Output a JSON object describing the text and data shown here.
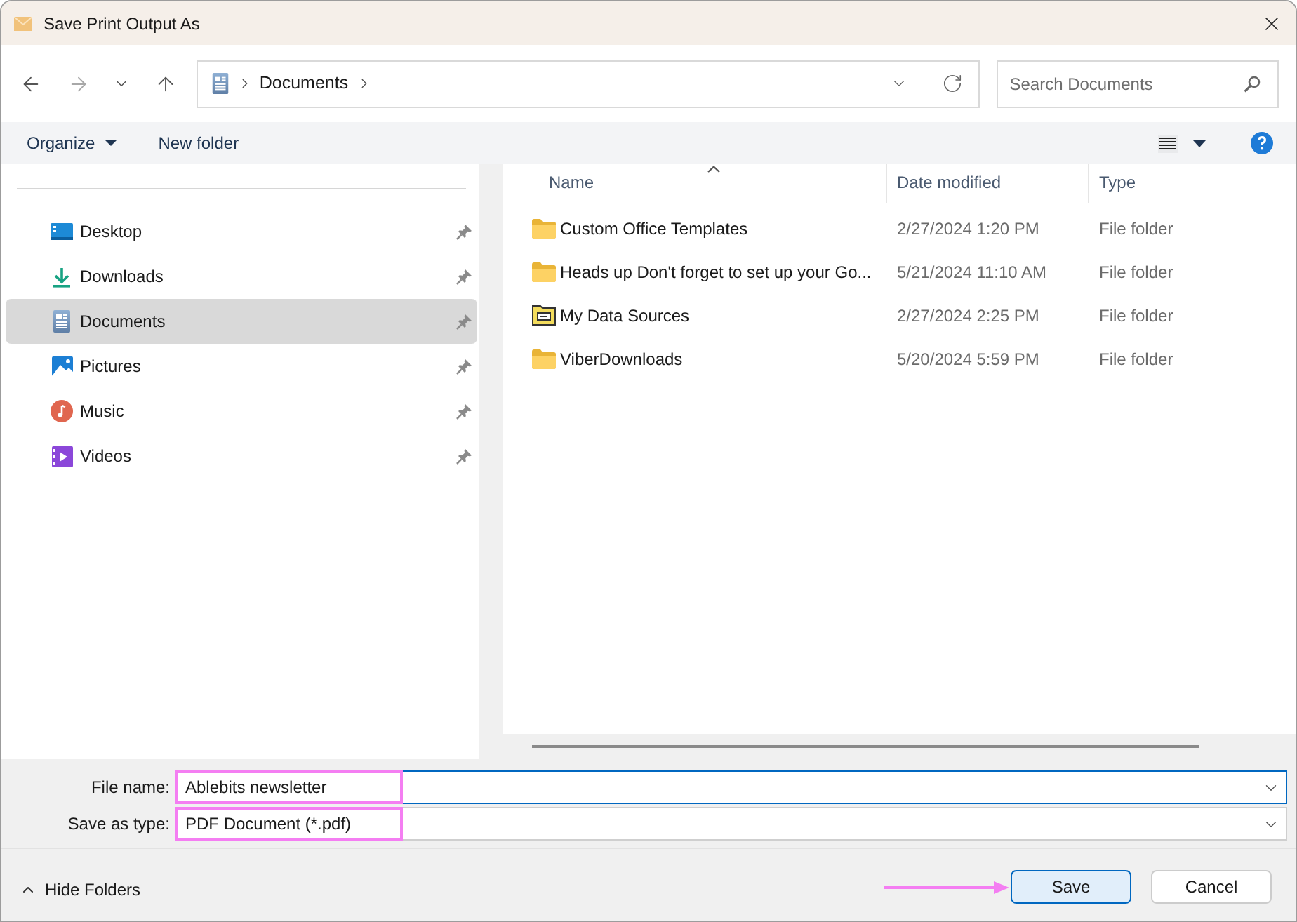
{
  "window": {
    "title": "Save Print Output As"
  },
  "nav": {
    "buttons": [
      {
        "kind": "back",
        "disabled": false
      },
      {
        "kind": "forward",
        "disabled": true
      },
      {
        "kind": "recent",
        "disabled": false
      },
      {
        "kind": "up",
        "disabled": false
      }
    ]
  },
  "address": {
    "path": [
      "Documents"
    ]
  },
  "search": {
    "placeholder": "Search Documents"
  },
  "toolbar": {
    "organize": "Organize",
    "new_folder": "New folder"
  },
  "sidebar": {
    "items": [
      {
        "label": "Desktop",
        "kind": "desktop",
        "selected": false,
        "pinned": true
      },
      {
        "label": "Downloads",
        "kind": "downloads",
        "selected": false,
        "pinned": true
      },
      {
        "label": "Documents",
        "kind": "documents",
        "selected": true,
        "pinned": true
      },
      {
        "label": "Pictures",
        "kind": "pictures",
        "selected": false,
        "pinned": true
      },
      {
        "label": "Music",
        "kind": "music",
        "selected": false,
        "pinned": true
      },
      {
        "label": "Videos",
        "kind": "videos",
        "selected": false,
        "pinned": true
      }
    ]
  },
  "file_list": {
    "columns": [
      {
        "label": "Name",
        "sorted": true
      },
      {
        "label": "Date modified",
        "sorted": false
      },
      {
        "label": "Type",
        "sorted": false
      }
    ],
    "rows": [
      {
        "name": "Custom Office Templates",
        "kind": "folder",
        "date": "2/27/2024 1:20 PM",
        "type": "File folder"
      },
      {
        "name": "Heads up Don't forget to set up your Go...",
        "kind": "folder",
        "date": "5/21/2024 11:10 AM",
        "type": "File folder"
      },
      {
        "name": "My Data Sources",
        "kind": "data-folder",
        "date": "2/27/2024 2:25 PM",
        "type": "File folder"
      },
      {
        "name": "ViberDownloads",
        "kind": "folder",
        "date": "5/20/2024 5:59 PM",
        "type": "File folder"
      }
    ]
  },
  "form": {
    "fields": [
      {
        "label": "File name:",
        "value": "Ablebits newsletter",
        "focused": true,
        "highlighted": true
      },
      {
        "label": "Save as type:",
        "value": "PDF Document (*.pdf)",
        "focused": false,
        "highlighted": true
      }
    ]
  },
  "footer": {
    "toggle": "Hide Folders",
    "buttons": [
      {
        "label": "Save",
        "kind": "primary",
        "pointed": true
      },
      {
        "label": "Cancel",
        "kind": "secondary",
        "pointed": false
      }
    ]
  }
}
